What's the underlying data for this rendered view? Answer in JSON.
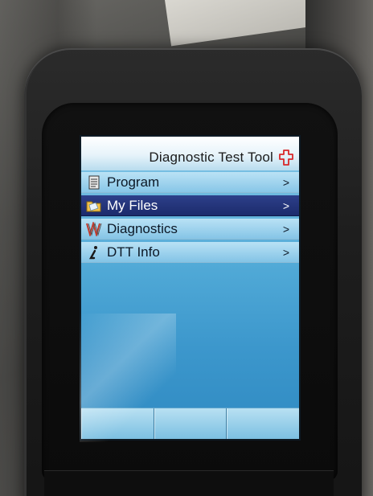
{
  "header": {
    "title": "Diagnostic Test Tool",
    "logo_icon": "red-cross-logo-icon"
  },
  "menu": {
    "items": [
      {
        "label": "Program",
        "arrow": ">",
        "icon": "document-icon",
        "selected": false
      },
      {
        "label": "My Files",
        "arrow": ">",
        "icon": "folder-icon",
        "selected": true
      },
      {
        "label": "Diagnostics",
        "arrow": ">",
        "icon": "waveform-icon",
        "selected": false
      },
      {
        "label": "DTT Info",
        "arrow": ">",
        "icon": "info-icon",
        "selected": false
      }
    ]
  },
  "softkeys": [
    "",
    "",
    ""
  ],
  "colors": {
    "selection": "#1c2b6c",
    "screen_bg": "#4fa8d6",
    "logo_red": "#d8282a"
  }
}
